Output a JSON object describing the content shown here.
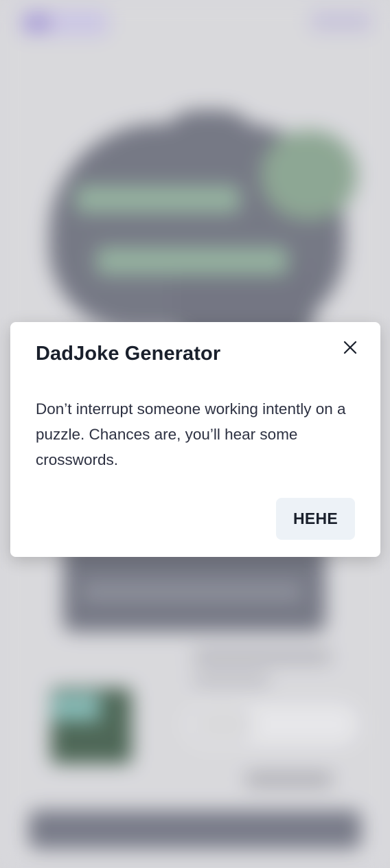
{
  "modal": {
    "title": "DadJoke Generator",
    "joke": "Don’t interrupt someone working intently on a puzzle. Chances are, you’ll hear some crosswords.",
    "button_label": "HEHE",
    "close_icon": "close-icon"
  },
  "colors": {
    "modal_background": "#ffffff",
    "title_text": "#1a202c",
    "body_text": "#2d3142",
    "button_background": "#edf2f7",
    "backdrop": "#dcdcdf"
  }
}
